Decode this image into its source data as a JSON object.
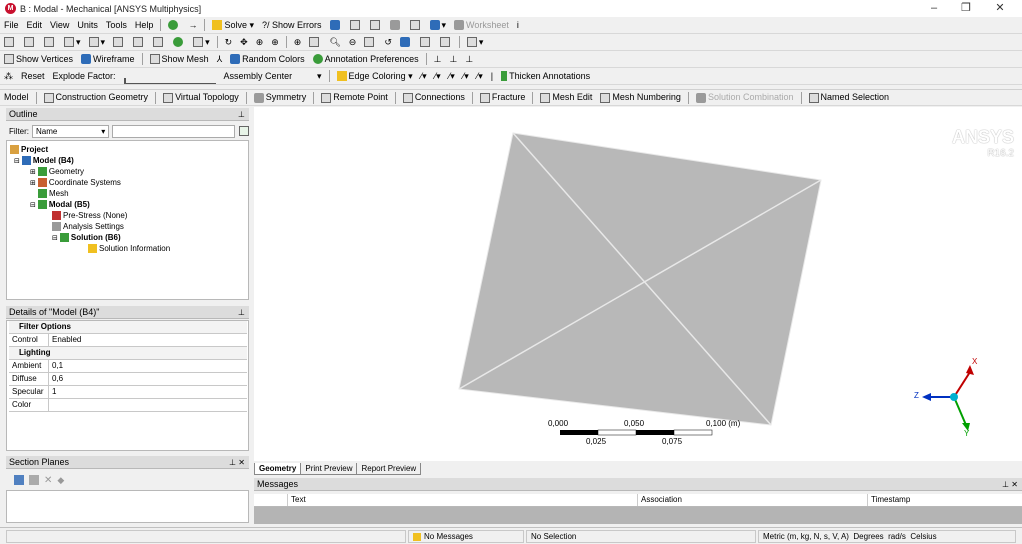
{
  "window": {
    "title": "B : Modal - Mechanical [ANSYS Multiphysics]",
    "minimize": "–",
    "maximize": "❐",
    "close": "✕"
  },
  "menubar": [
    "File",
    "Edit",
    "View",
    "Units",
    "Tools",
    "Help"
  ],
  "toolbar1": {
    "solve": "Solve",
    "show_errors": "?/ Show Errors",
    "worksheet": "Worksheet"
  },
  "toolbar3": {
    "show_vertices": "Show Vertices",
    "wireframe": "Wireframe",
    "show_mesh": "Show Mesh",
    "random_colors": "Random Colors",
    "annotation_preferences": "Annotation Preferences"
  },
  "toolbar4": {
    "reset": "Reset",
    "explode_factor": "Explode Factor:",
    "assembly_center": "Assembly Center",
    "edge_coloring": "Edge Coloring",
    "thicken_annotations": "Thicken Annotations"
  },
  "context_toolbar": {
    "model": "Model",
    "construction_geometry": "Construction Geometry",
    "virtual_topology": "Virtual Topology",
    "symmetry": "Symmetry",
    "remote_point": "Remote Point",
    "connections": "Connections",
    "fracture": "Fracture",
    "mesh_edit": "Mesh Edit",
    "mesh_numbering": "Mesh Numbering",
    "solution_combination": "Solution Combination",
    "named_selection": "Named Selection"
  },
  "outline": {
    "title": "Outline",
    "filter_label": "Filter:",
    "filter_value": "Name",
    "tree": [
      {
        "label": "Project",
        "bold": true
      },
      {
        "label": "Model (B4)",
        "bold": true
      },
      {
        "label": "Geometry",
        "bold": false
      },
      {
        "label": "Coordinate Systems",
        "bold": false
      },
      {
        "label": "Mesh",
        "bold": false
      },
      {
        "label": "Modal (B5)",
        "bold": true
      },
      {
        "label": "Pre-Stress (None)",
        "bold": false
      },
      {
        "label": "Analysis Settings",
        "bold": false
      },
      {
        "label": "Solution (B6)",
        "bold": true
      },
      {
        "label": "Solution Information",
        "bold": false
      }
    ]
  },
  "details": {
    "title": "Details of \"Model (B4)\"",
    "filter_options": "Filter Options",
    "control_key": "Control",
    "control_val": "Enabled",
    "lighting": "Lighting",
    "ambient_key": "Ambient",
    "ambient_val": "0,1",
    "diffuse_key": "Diffuse",
    "diffuse_val": "0,6",
    "specular_key": "Specular",
    "specular_val": "1",
    "color_key": "Color",
    "color_val": ""
  },
  "section_planes": {
    "title": "Section Planes"
  },
  "viewport": {
    "brand": "ANSYS",
    "version": "R16.2",
    "scale_top": [
      "0,000",
      "0,050",
      "0,100 (m)"
    ],
    "scale_bottom": [
      "0,025",
      "0,075"
    ],
    "axis_x": "X",
    "axis_y": "Y",
    "axis_z": "Z"
  },
  "tabs": [
    "Geometry",
    "Print Preview",
    "Report Preview"
  ],
  "messages": {
    "title": "Messages",
    "columns": [
      "Text",
      "Association",
      "Timestamp"
    ]
  },
  "statusbar": {
    "messages": "No Messages",
    "selection": "No Selection",
    "units": "Metric (m, kg, N, s, V, A)",
    "angle": "Degrees",
    "rate": "rad/s",
    "temp": "Celsius"
  },
  "colors": {
    "plate": "#b8b8b8",
    "accent": "#2e6cb8",
    "axis_x": "#c00000",
    "axis_y": "#00a000",
    "axis_z": "#0030c0"
  }
}
